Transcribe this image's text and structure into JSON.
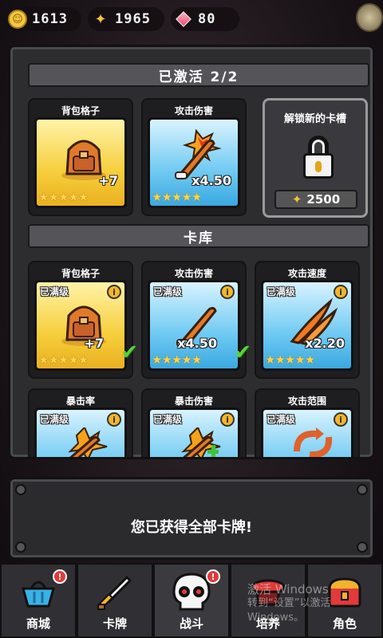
{
  "resources": {
    "coins": "1613",
    "fish": "1965",
    "gems": "80"
  },
  "active_section": {
    "title": "已激活 2/2",
    "cards": [
      {
        "name": "背包格子",
        "value": "+7",
        "stars": 5,
        "color": "gold"
      },
      {
        "name": "攻击伤害",
        "value": "x4.50",
        "stars": 5,
        "color": "blue"
      }
    ],
    "locked_slot": {
      "label": "解锁新的卡槽",
      "price": "2500"
    }
  },
  "library_section": {
    "title": "卡库",
    "cards": [
      {
        "name": "背包格子",
        "level": "已满级",
        "value": "+7",
        "stars": 5,
        "color": "gold",
        "checked": true
      },
      {
        "name": "攻击伤害",
        "level": "已满级",
        "value": "x4.50",
        "stars": 5,
        "color": "blue",
        "checked": true
      },
      {
        "name": "攻击速度",
        "level": "已满级",
        "value": "x2.20",
        "stars": 5,
        "color": "blue",
        "checked": false
      },
      {
        "name": "暴击率",
        "level": "已满级",
        "value": "",
        "stars": 0,
        "color": "blue",
        "checked": false
      },
      {
        "name": "暴击伤害",
        "level": "已满级",
        "value": "",
        "stars": 0,
        "color": "blue",
        "checked": false
      },
      {
        "name": "攻击范围",
        "level": "已满级",
        "value": "",
        "stars": 0,
        "color": "blue",
        "checked": false
      }
    ]
  },
  "message": "您已获得全部卡牌!",
  "nav": [
    {
      "label": "商城",
      "icon": "basket-icon",
      "badge": "!"
    },
    {
      "label": "卡牌",
      "icon": "sword-icon",
      "badge": ""
    },
    {
      "label": "战斗",
      "icon": "skull-icon",
      "badge": "!"
    },
    {
      "label": "培养",
      "icon": "anvil-icon",
      "badge": ""
    },
    {
      "label": "角色",
      "icon": "chest-icon",
      "badge": ""
    }
  ],
  "watermark": {
    "line1": "激活 Windows",
    "line2": "转到“设置”以激活 Windows。"
  },
  "colors": {
    "gold_card": "#f6cf3c",
    "blue_card": "#6fcaf2",
    "badge_red": "#e23a3a",
    "star": "#ffd34a"
  }
}
